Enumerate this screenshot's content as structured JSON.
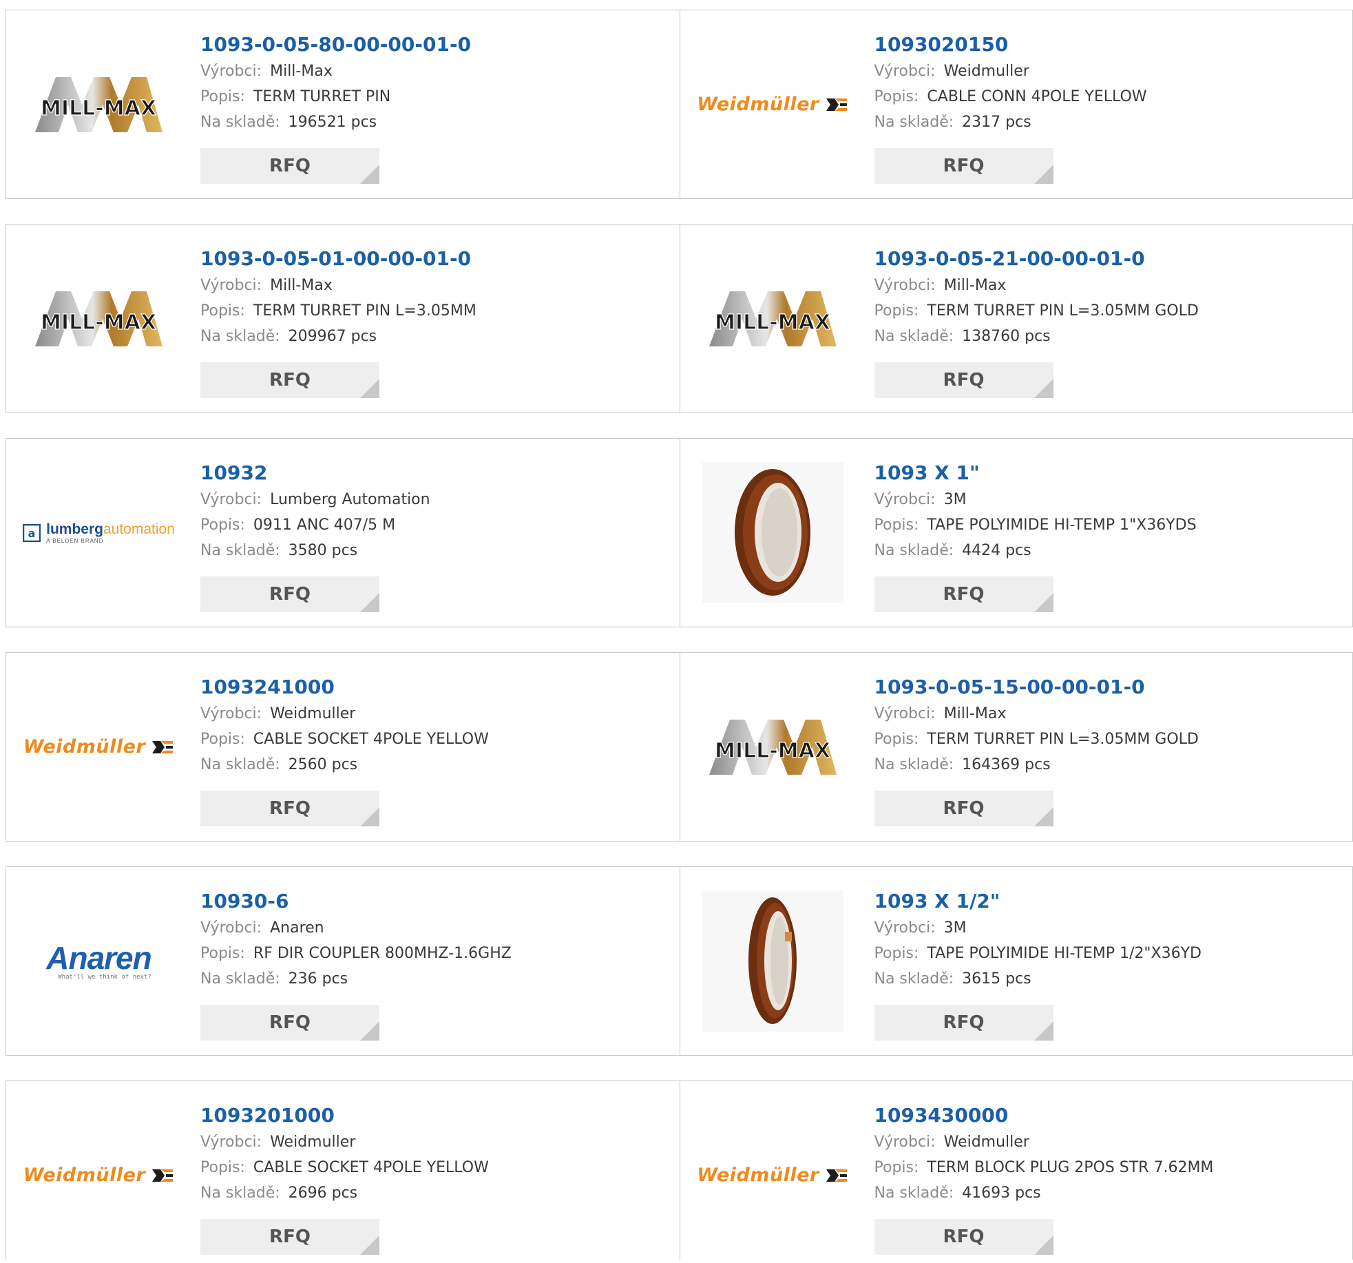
{
  "labels": {
    "manufacturer": "Výrobci:",
    "description": "Popis:",
    "stock": "Na skladě:",
    "rfq": "RFQ"
  },
  "products": [
    {
      "part_number": "1093-0-05-80-00-00-01-0",
      "manufacturer": "Mill-Max",
      "description": "TERM TURRET PIN",
      "stock": "196521 pcs",
      "logo": "MILL-MAX",
      "logo_type": "millmax"
    },
    {
      "part_number": "1093020150",
      "manufacturer": "Weidmuller",
      "description": "CABLE CONN 4POLE YELLOW",
      "stock": "2317 pcs",
      "logo": "Weidmüller",
      "logo_type": "weidmuller"
    },
    {
      "part_number": "1093-0-05-01-00-00-01-0",
      "manufacturer": "Mill-Max",
      "description": "TERM TURRET PIN L=3.05MM",
      "stock": "209967 pcs",
      "logo": "MILL-MAX",
      "logo_type": "millmax"
    },
    {
      "part_number": "1093-0-05-21-00-00-01-0",
      "manufacturer": "Mill-Max",
      "description": "TERM TURRET PIN L=3.05MM GOLD",
      "stock": "138760 pcs",
      "logo": "MILL-MAX",
      "logo_type": "millmax"
    },
    {
      "part_number": "10932",
      "manufacturer": "Lumberg Automation",
      "description": "0911 ANC 407/5 M",
      "stock": "3580 pcs",
      "logo": "lumbergautomation",
      "logo_sub": "A BELDEN BRAND",
      "logo_type": "lumberg"
    },
    {
      "part_number": "1093 X 1\"",
      "manufacturer": "3M",
      "description": "TAPE POLYIMIDE HI-TEMP 1\"X36YDS",
      "stock": "4424 pcs",
      "logo_type": "tape-wide"
    },
    {
      "part_number": "1093241000",
      "manufacturer": "Weidmuller",
      "description": "CABLE SOCKET 4POLE YELLOW",
      "stock": "2560 pcs",
      "logo": "Weidmüller",
      "logo_type": "weidmuller"
    },
    {
      "part_number": "1093-0-05-15-00-00-01-0",
      "manufacturer": "Mill-Max",
      "description": "TERM TURRET PIN L=3.05MM GOLD",
      "stock": "164369 pcs",
      "logo": "MILL-MAX",
      "logo_type": "millmax"
    },
    {
      "part_number": "10930-6",
      "manufacturer": "Anaren",
      "description": "RF DIR COUPLER 800MHZ-1.6GHZ",
      "stock": "236 pcs",
      "logo": "Anaren",
      "logo_sub": "What'll we think of next?",
      "logo_type": "anaren"
    },
    {
      "part_number": "1093 X 1/2\"",
      "manufacturer": "3M",
      "description": "TAPE POLYIMIDE HI-TEMP 1/2\"X36YD",
      "stock": "3615 pcs",
      "logo_type": "tape-narrow"
    },
    {
      "part_number": "1093201000",
      "manufacturer": "Weidmuller",
      "description": "CABLE SOCKET 4POLE YELLOW",
      "stock": "2696 pcs",
      "logo": "Weidmüller",
      "logo_type": "weidmuller"
    },
    {
      "part_number": "1093430000",
      "manufacturer": "Weidmuller",
      "description": "TERM BLOCK PLUG 2POS STR 7.62MM",
      "stock": "41693 pcs",
      "logo": "Weidmüller",
      "logo_type": "weidmuller"
    }
  ],
  "colors": {
    "link": "#1a5fa8",
    "label": "#8a8a8a",
    "value": "#3a3a3a",
    "border": "#c9c9c9",
    "rfq_bg": "#eeeeee"
  }
}
